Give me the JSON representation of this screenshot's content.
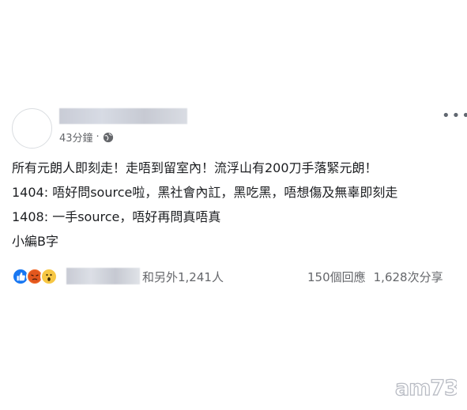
{
  "post": {
    "time": "43分鐘",
    "lines": [
      "所有元朗人即刻走！走唔到留室內！流浮山有200刀手落緊元朗！",
      "1404: 唔好問source啦，黑社會內訌，黑吃黑，唔想傷及無辜即刻走",
      "1408: 一手source，唔好再問真唔真",
      "小編B字"
    ]
  },
  "reactions": {
    "others": "和另外1,241人",
    "comments": "150個回應",
    "shares": "1,628次分享"
  },
  "watermark": {
    "brand": "am730"
  }
}
